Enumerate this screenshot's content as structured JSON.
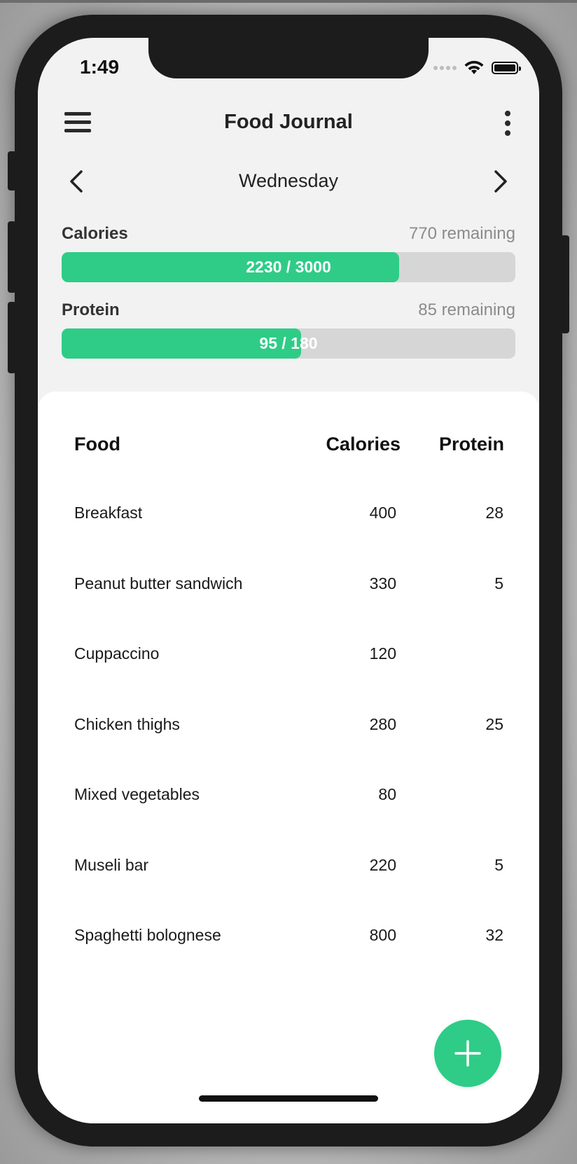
{
  "status_bar": {
    "time": "1:49"
  },
  "header": {
    "title": "Food Journal"
  },
  "day_nav": {
    "day": "Wednesday"
  },
  "metrics": [
    {
      "name": "Calories",
      "remaining": "770 remaining",
      "progress_text": "2230 / 3000",
      "consumed": 2230,
      "goal": 3000
    },
    {
      "name": "Protein",
      "remaining": "85 remaining",
      "progress_text": "95 / 180",
      "consumed": 95,
      "goal": 180
    }
  ],
  "table": {
    "columns": [
      "Food",
      "Calories",
      "Protein"
    ],
    "rows": [
      {
        "food": "Breakfast",
        "calories": "400",
        "protein": "28"
      },
      {
        "food": "Peanut butter sandwich",
        "calories": "330",
        "protein": "5"
      },
      {
        "food": "Cuppaccino",
        "calories": "120",
        "protein": ""
      },
      {
        "food": "Chicken thighs",
        "calories": "280",
        "protein": "25"
      },
      {
        "food": "Mixed vegetables",
        "calories": "80",
        "protein": ""
      },
      {
        "food": "Museli bar",
        "calories": "220",
        "protein": "5"
      },
      {
        "food": "Spaghetti bolognese",
        "calories": "800",
        "protein": "32"
      }
    ]
  },
  "colors": {
    "accent": "#2ecc87",
    "track": "#d6d6d6"
  },
  "icons": {
    "menu": "hamburger-menu-icon",
    "more": "more-vertical-icon",
    "prev": "chevron-left-icon",
    "next": "chevron-right-icon",
    "add": "plus-icon"
  }
}
